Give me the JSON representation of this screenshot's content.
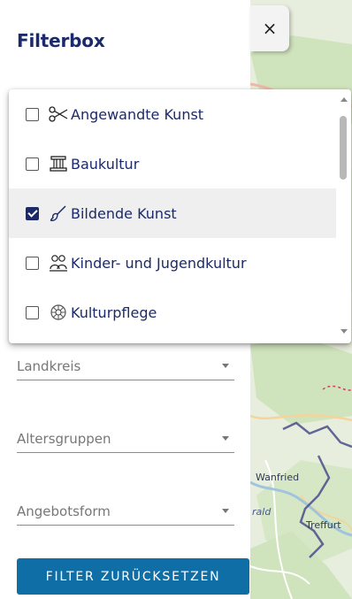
{
  "panel": {
    "title": "Filterbox"
  },
  "close_button": {
    "label": "×"
  },
  "dropdown": {
    "options": [
      {
        "label": "Angewandte Kunst",
        "icon": "scissors-icon",
        "checked": false
      },
      {
        "label": "Baukultur",
        "icon": "column-icon",
        "checked": false
      },
      {
        "label": "Bildende Kunst",
        "icon": "brush-icon",
        "checked": true
      },
      {
        "label": "Kinder- und Jugendkultur",
        "icon": "children-icon",
        "checked": false
      },
      {
        "label": "Kulturpflege",
        "icon": "ornament-icon",
        "checked": false
      }
    ]
  },
  "filters": {
    "landkreis_label": "Landkreis",
    "altersgruppen_label": "Altersgruppen",
    "angebotsform_label": "Angebotsform"
  },
  "reset_button": {
    "label": "FILTER ZURÜCKSETZEN"
  },
  "map": {
    "labels": {
      "wanfried": "Wanfried",
      "treffurt": "Treffurt",
      "rald": "rald"
    }
  },
  "colors": {
    "accent": "#1b2a6a",
    "button": "#0f6ea6"
  }
}
